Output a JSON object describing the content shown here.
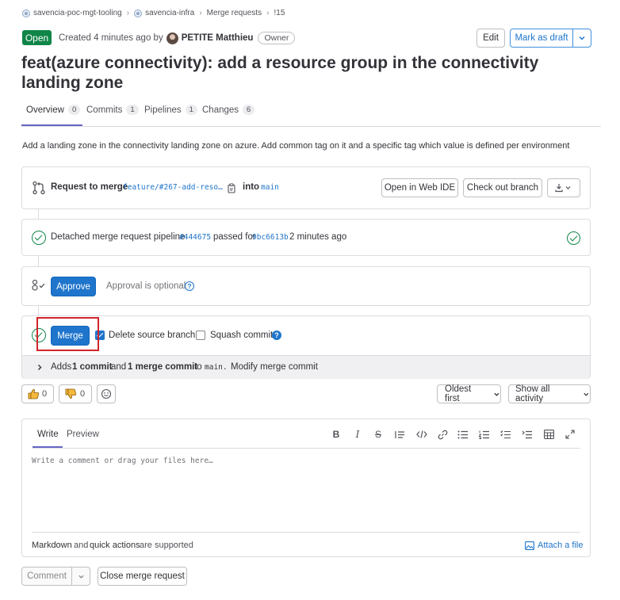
{
  "breadcrumb": {
    "items": [
      "savencia-poc-mgt-tooling",
      "savencia-infra",
      "Merge requests",
      "!15"
    ],
    "separator": "›"
  },
  "header": {
    "status": "Open",
    "created_text": "Created 4 minutes ago by",
    "author": "PETITE Matthieu",
    "role": "Owner",
    "edit_label": "Edit",
    "draft_label": "Mark as draft"
  },
  "title": "feat(azure connectivity): add a resource group in the connectivity landing zone",
  "tabs": [
    {
      "label": "Overview",
      "count": "0"
    },
    {
      "label": "Commits",
      "count": "1"
    },
    {
      "label": "Pipelines",
      "count": "1"
    },
    {
      "label": "Changes",
      "count": "6"
    }
  ],
  "description": "Add a landing zone in the connectivity landing zone on azure. Add common tag on it and a specific tag which value is defined per environment",
  "request": {
    "label": "Request to merge",
    "source_branch": "feature/#267-add-reso…",
    "into": "into",
    "target_branch": "main",
    "web_ide": "Open in Web IDE",
    "checkout": "Check out branch"
  },
  "pipeline": {
    "text": "Detached merge request pipeline",
    "id": "#444675",
    "passed": "passed for",
    "sha": "9bc6613b",
    "time": "2 minutes ago"
  },
  "approval": {
    "button": "Approve",
    "text": "Approval is optional"
  },
  "merge": {
    "button": "Merge",
    "delete_source": "Delete source branch",
    "delete_checked": true,
    "squash": "Squash commits",
    "squash_checked": false,
    "footer_adds": "Adds",
    "footer_commit": "1 commit",
    "footer_and": "and",
    "footer_merge_commit": "1 merge commit",
    "footer_to": "to",
    "footer_branch": "main.",
    "footer_modify": "Modify merge commit"
  },
  "reactions": {
    "thumbs_up": "0",
    "thumbs_down": "0"
  },
  "activity": {
    "sort": "Oldest first",
    "filter": "Show all activity"
  },
  "comment": {
    "tab_write": "Write",
    "tab_preview": "Preview",
    "placeholder": "Write a comment or drag your files here…",
    "markdown": "Markdown",
    "and": "and",
    "quick_actions": "quick actions",
    "supported": "are supported",
    "attach": "Attach a file",
    "submit": "Comment",
    "close": "Close merge request"
  },
  "colors": {
    "open_badge": "#108548",
    "primary": "#1f75cb",
    "highlight_box": "#d2252a",
    "tab_underline": "#6666c4"
  }
}
